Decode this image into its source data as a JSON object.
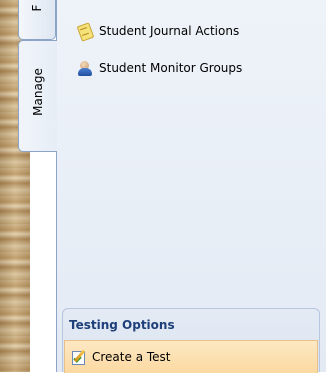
{
  "tabs": {
    "top_tab_label": "F",
    "active_tab_label": "Manage"
  },
  "manage_list": {
    "items": [
      {
        "label": "Student Journal Actions",
        "icon": "journal-icon"
      },
      {
        "label": "Student Monitor Groups",
        "icon": "monitor-groups-icon"
      }
    ]
  },
  "testing_options": {
    "header": "Testing Options",
    "items": [
      {
        "label": "Create a Test",
        "icon": "create-test-icon"
      }
    ]
  },
  "colors": {
    "panel_bg": "#e8eef6",
    "tab_border": "#8ba4c8",
    "section_header": "#1e3f7a",
    "highlight_bg": "#fbd9a1"
  }
}
